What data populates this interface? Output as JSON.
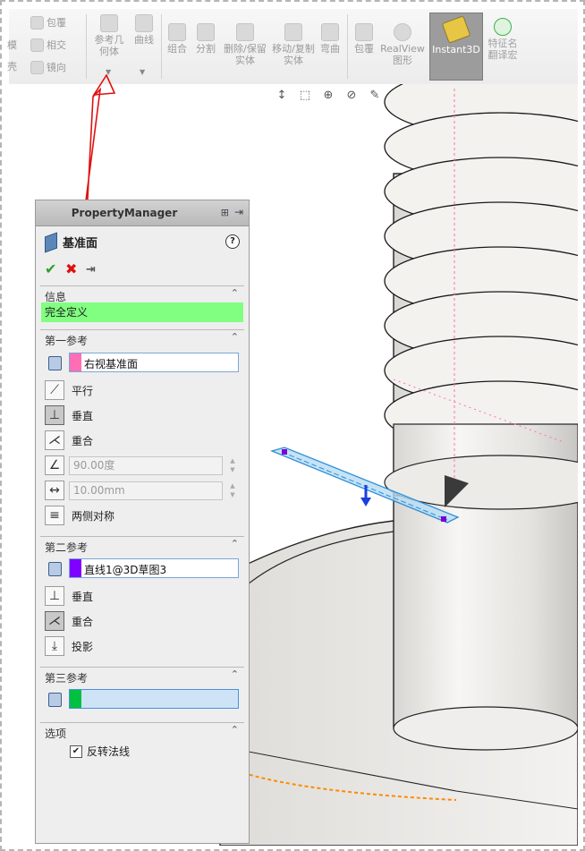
{
  "ribbon": {
    "row1_left": [
      "包覆",
      "相交",
      "镜向"
    ],
    "row1_left_clipped": [
      "模",
      "壳"
    ],
    "buttons": [
      "参考几何体",
      "曲线",
      "组合",
      "分割",
      "删除/保留实体",
      "移动/复制实体",
      "弯曲",
      "包覆",
      "RealView图形",
      "Instant3D",
      "特征名翻译宏"
    ]
  },
  "pm": {
    "header": "PropertyManager",
    "title": "基准面",
    "sections": {
      "info": "信息",
      "status": "完全定义",
      "first": "第一参考",
      "second": "第二参考",
      "third": "第三参考",
      "options": "选项"
    },
    "first_ref": {
      "selection": "右视基准面",
      "parallel": "平行",
      "perpendicular": "垂直",
      "coincident": "重合",
      "angle": "90.00度",
      "distance": "10.00mm",
      "symmetric": "两侧对称"
    },
    "second_ref": {
      "selection": "直线1@3D草图3",
      "perpendicular": "垂直",
      "coincident": "重合",
      "project": "投影"
    },
    "third_ref": {
      "selection": ""
    },
    "options": {
      "flip_normal": "反转法线",
      "flip_checked": true
    }
  },
  "colors": {
    "first_swatch": "#ff6eb4",
    "second_swatch": "#8000ff",
    "third_swatch": "#00c040",
    "status_bg": "#80ff80",
    "arrow": "#e01010"
  }
}
